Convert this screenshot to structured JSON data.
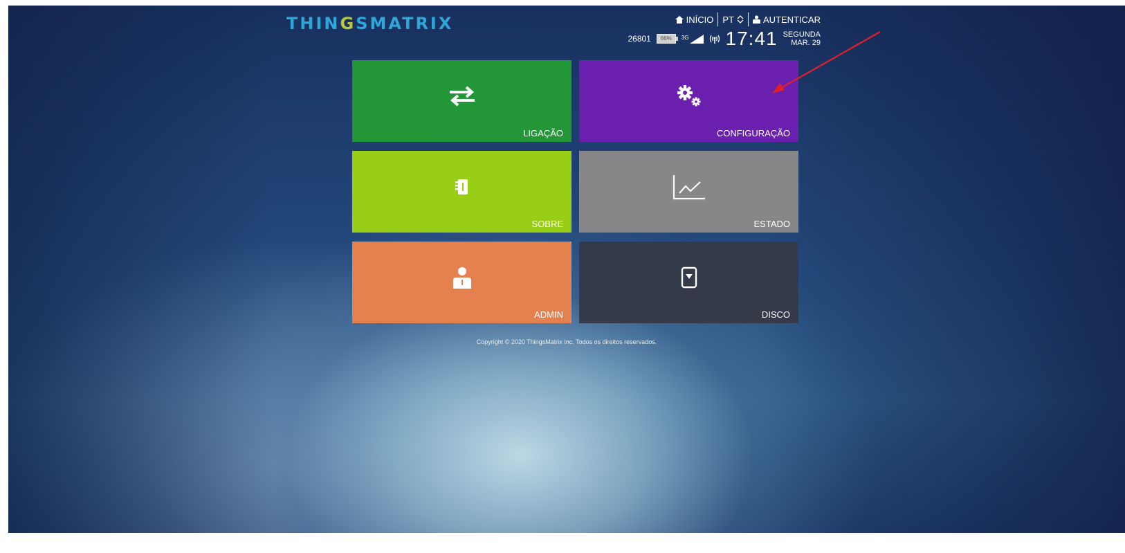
{
  "header": {
    "logo_text": "THIN",
    "logo_wave": "G",
    "logo_rest": "SMATRIX",
    "nav_home": "INÍCIO",
    "nav_lang": "PT",
    "nav_auth": "AUTENTICAR"
  },
  "status": {
    "operator_code": "26801",
    "battery": "66%",
    "network": "3G",
    "time": "17:41",
    "day": "SEGUNDA",
    "date": "MAR. 29"
  },
  "tiles": [
    {
      "label": "LIGAÇÃO",
      "color": "#239637",
      "icon": "arrows-exchange-icon"
    },
    {
      "label": "CONFIGURAÇÃO",
      "color": "#6a1fae",
      "icon": "gears-icon"
    },
    {
      "label": "SOBRE",
      "color": "#98ce16",
      "icon": "notebook-icon"
    },
    {
      "label": "ESTADO",
      "color": "#87878a",
      "icon": "line-chart-icon"
    },
    {
      "label": "ADMIN",
      "color": "#e5804f",
      "icon": "user-icon"
    },
    {
      "label": "DISCO",
      "color": "#343a4a",
      "icon": "sd-card-icon"
    }
  ],
  "footer": {
    "copyright": "Copyright © 2020 ThingsMatrix Inc. Todos os direitos reservados."
  },
  "colors": {
    "accent_logo": "#2ea7d8",
    "annotation_arrow": "#e0202a"
  }
}
